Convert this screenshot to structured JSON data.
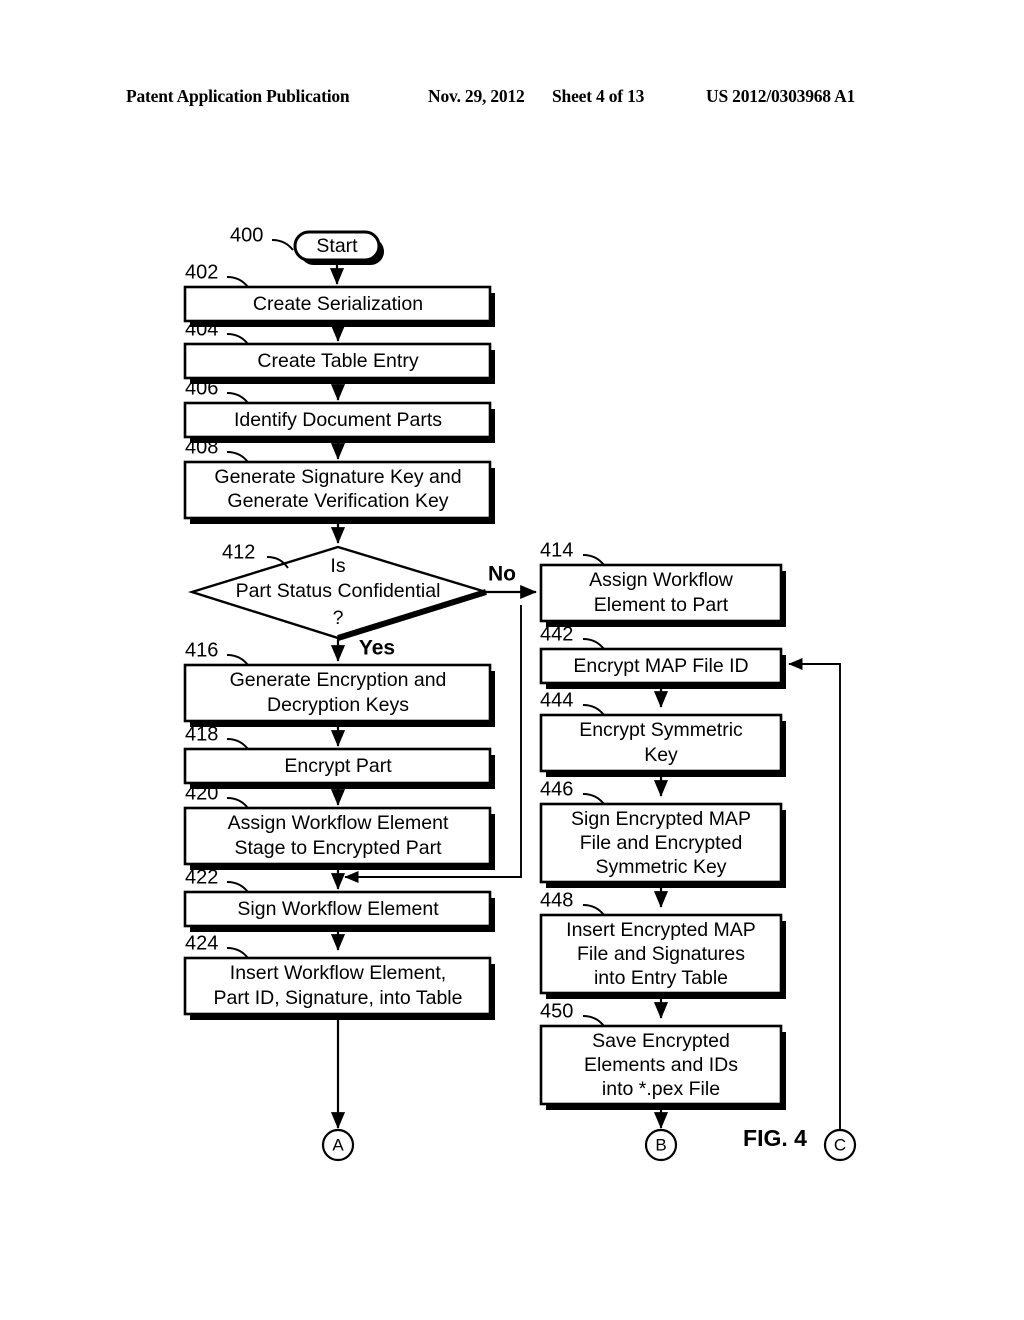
{
  "header": {
    "publication": "Patent Application Publication",
    "date": "Nov. 29, 2012",
    "sheet": "Sheet 4 of 13",
    "document_number": "US 2012/0303968 A1"
  },
  "figure": {
    "label": "FIG. 4",
    "title": "FIG. 4"
  },
  "chart_data": {
    "type": "flowchart",
    "title": "FIG. 4",
    "nodes": [
      {
        "ref": "400",
        "shape": "terminator",
        "text": "Start"
      },
      {
        "ref": "402",
        "shape": "process",
        "text": "Create Serialization"
      },
      {
        "ref": "404",
        "shape": "process",
        "text": "Create Table Entry"
      },
      {
        "ref": "406",
        "shape": "process",
        "text": "Identify Document Parts"
      },
      {
        "ref": "408",
        "shape": "process",
        "text": "Generate Signature Key and Generate Verification Key"
      },
      {
        "ref": "412",
        "shape": "decision",
        "text": "Is Part Status Confidential ?"
      },
      {
        "ref": "414",
        "shape": "process",
        "text": "Assign Workflow Element to Part"
      },
      {
        "ref": "416",
        "shape": "process",
        "text": "Generate Encryption and Decryption Keys"
      },
      {
        "ref": "418",
        "shape": "process",
        "text": "Encrypt Part"
      },
      {
        "ref": "420",
        "shape": "process",
        "text": "Assign Workflow Element Stage to Encrypted Part"
      },
      {
        "ref": "422",
        "shape": "process",
        "text": "Sign Workflow Element"
      },
      {
        "ref": "424",
        "shape": "process",
        "text": "Insert Workflow Element, Part ID, Signature, into Table"
      },
      {
        "ref": "442",
        "shape": "process",
        "text": "Encrypt MAP File ID"
      },
      {
        "ref": "444",
        "shape": "process",
        "text": "Encrypt Symmetric Key"
      },
      {
        "ref": "446",
        "shape": "process",
        "text": "Sign Encrypted MAP File and Encrypted Symmetric Key"
      },
      {
        "ref": "448",
        "shape": "process",
        "text": "Insert Encrypted MAP File and Signatures into Entry Table"
      },
      {
        "ref": "450",
        "shape": "process",
        "text": "Save Encrypted Elements and IDs into *.pex File"
      },
      {
        "ref": "A",
        "shape": "connector",
        "text": "A"
      },
      {
        "ref": "B",
        "shape": "connector",
        "text": "B"
      },
      {
        "ref": "C",
        "shape": "connector",
        "text": "C"
      }
    ],
    "edges": [
      {
        "from": "400",
        "to": "402",
        "label": ""
      },
      {
        "from": "402",
        "to": "404",
        "label": ""
      },
      {
        "from": "404",
        "to": "406",
        "label": ""
      },
      {
        "from": "406",
        "to": "408",
        "label": ""
      },
      {
        "from": "408",
        "to": "412",
        "label": ""
      },
      {
        "from": "412",
        "to": "414",
        "label": "No"
      },
      {
        "from": "412",
        "to": "416",
        "label": "Yes"
      },
      {
        "from": "414",
        "to": "422",
        "label": ""
      },
      {
        "from": "416",
        "to": "418",
        "label": ""
      },
      {
        "from": "418",
        "to": "420",
        "label": ""
      },
      {
        "from": "420",
        "to": "422",
        "label": ""
      },
      {
        "from": "422",
        "to": "424",
        "label": ""
      },
      {
        "from": "424",
        "to": "A",
        "label": ""
      },
      {
        "from": "442",
        "to": "444",
        "label": ""
      },
      {
        "from": "444",
        "to": "446",
        "label": ""
      },
      {
        "from": "446",
        "to": "448",
        "label": ""
      },
      {
        "from": "448",
        "to": "450",
        "label": ""
      },
      {
        "from": "450",
        "to": "B",
        "label": ""
      },
      {
        "from": "C",
        "to": "442",
        "label": ""
      }
    ]
  },
  "nodes": {
    "n400": {
      "ref": "400",
      "text": "Start"
    },
    "n402": {
      "ref": "402",
      "line1": "Create Serialization"
    },
    "n404": {
      "ref": "404",
      "line1": "Create Table Entry"
    },
    "n406": {
      "ref": "406",
      "line1": "Identify Document Parts"
    },
    "n408": {
      "ref": "408",
      "line1": "Generate Signature Key and",
      "line2": "Generate Verification Key"
    },
    "n412": {
      "ref": "412",
      "line1": "Is",
      "line2": "Part Status Confidential",
      "line3": "?"
    },
    "n414": {
      "ref": "414",
      "line1": "Assign Workflow",
      "line2": "Element to Part"
    },
    "n416": {
      "ref": "416",
      "line1": "Generate Encryption and",
      "line2": "Decryption Keys"
    },
    "n418": {
      "ref": "418",
      "line1": "Encrypt Part"
    },
    "n420": {
      "ref": "420",
      "line1": "Assign Workflow Element",
      "line2": "Stage to Encrypted Part"
    },
    "n422": {
      "ref": "422",
      "line1": "Sign Workflow Element"
    },
    "n424": {
      "ref": "424",
      "line1": "Insert Workflow Element,",
      "line2": "Part ID, Signature, into Table"
    },
    "n442": {
      "ref": "442",
      "line1": "Encrypt MAP File ID"
    },
    "n444": {
      "ref": "444",
      "line1": "Encrypt Symmetric",
      "line2": "Key"
    },
    "n446": {
      "ref": "446",
      "line1": "Sign Encrypted MAP",
      "line2": "File and Encrypted",
      "line3": "Symmetric Key"
    },
    "n448": {
      "ref": "448",
      "line1": "Insert Encrypted MAP",
      "line2": "File and Signatures",
      "line3": "into Entry Table"
    },
    "n450": {
      "ref": "450",
      "line1": "Save Encrypted",
      "line2": "Elements and IDs",
      "line3": "into *.pex File"
    }
  },
  "branches": {
    "no": "No",
    "yes": "Yes"
  },
  "connectors": {
    "a": "A",
    "b": "B",
    "c": "C"
  },
  "colors": {
    "ink": "#000000",
    "paper": "#ffffff"
  }
}
